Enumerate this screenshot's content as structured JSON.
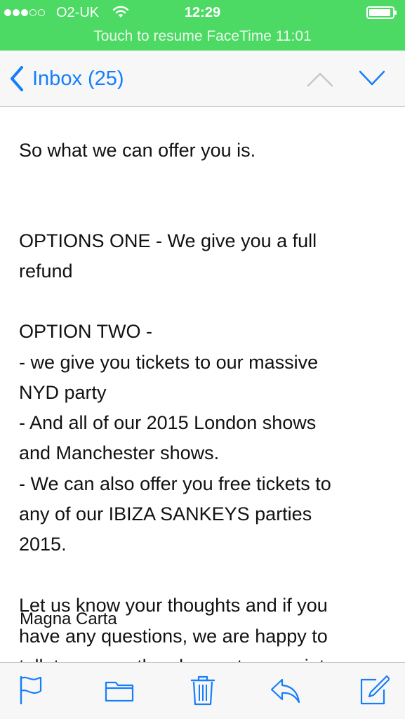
{
  "status_bar": {
    "carrier": "O2-UK",
    "time": "12:29",
    "banner": "Touch to resume FaceTime 11:01",
    "background_color": "#4cd964",
    "signal_bars_filled": 3,
    "signal_bars_total": 5
  },
  "nav": {
    "back_label": "Inbox (25)",
    "accent_color": "#157efb",
    "icons": {
      "back": "chevron-left-icon",
      "previous": "chevron-up-icon",
      "next": "chevron-down-icon"
    }
  },
  "email": {
    "lines": [
      "So what we can offer you is.",
      "OPTIONS ONE - We give you a full",
      "refund",
      "OPTION TWO -",
      "- we give you tickets to our massive",
      "NYD party",
      "- And all of our 2015 London shows",
      "and Manchester shows.",
      "- We can also offer you free tickets to",
      "any of our IBIZA SANKEYS parties",
      "2015.",
      "Let us know your thoughts and if you",
      "have any questions, we are happy to",
      "talk to you on the phone at any point"
    ],
    "overlay_text": "Magna Carta"
  },
  "toolbar": {
    "icons": [
      "flag-icon",
      "folder-icon",
      "trash-icon",
      "reply-icon",
      "compose-icon"
    ]
  }
}
